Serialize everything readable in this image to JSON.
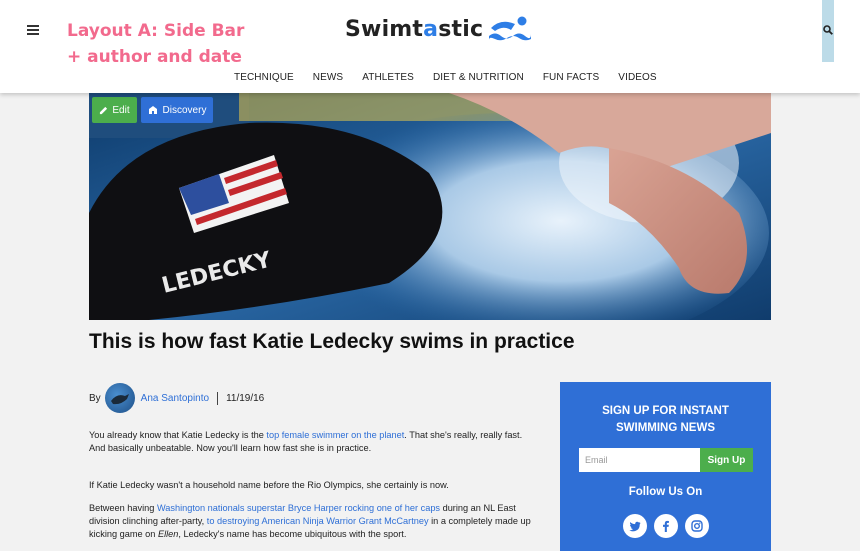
{
  "annotation": {
    "line1": "Layout A: Side Bar",
    "line2": "+ author and date"
  },
  "brand": {
    "name_part1": "Swimt",
    "name_accent": "a",
    "name_part2": "stic",
    "accent_color": "#2e7ee6"
  },
  "nav": {
    "items": [
      "TECHNIQUE",
      "NEWS",
      "ATHLETES",
      "DIET & NUTRITION",
      "FUN FACTS",
      "VIDEOS"
    ]
  },
  "admin": {
    "edit_label": "Edit",
    "discovery_label": "Discovery"
  },
  "hero": {
    "cap_text": "LEDECKY"
  },
  "article": {
    "title": "This is how fast Katie Ledecky swims in practice",
    "by": "By",
    "author": "Ana Santopinto",
    "date": "11/19/16",
    "p1_a": "You already know that Katie Ledecky is the ",
    "p1_link": "top female swimmer on the planet",
    "p1_b": ". That she's really, really fast. And basically unbeatable. Now you'll learn how fast she is in practice.",
    "p2": "If Katie Ledecky wasn't a household name before the Rio Olympics, she certainly is now.",
    "p3_a": "Between having ",
    "p3_link1": "Washington nationals superstar Bryce Harper rocking one of her caps",
    "p3_b": " during an NL East division clinching after-party, ",
    "p3_link2": "to destroying American Ninja Warrior Grant McCartney",
    "p3_c": " in a completely made up kicking game on ",
    "p3_em": "Ellen",
    "p3_d": ", Ledecky's name has become ubiquitous with the sport."
  },
  "signup": {
    "title_line1": "SIGN UP FOR INSTANT",
    "title_line2": "SWIMMING NEWS",
    "email_placeholder": "Email",
    "button": "Sign Up",
    "follow": "Follow Us On",
    "color": "#2f6fd6",
    "button_color": "#4cae4c"
  },
  "social": [
    "twitter-icon",
    "facebook-icon",
    "instagram-icon"
  ]
}
